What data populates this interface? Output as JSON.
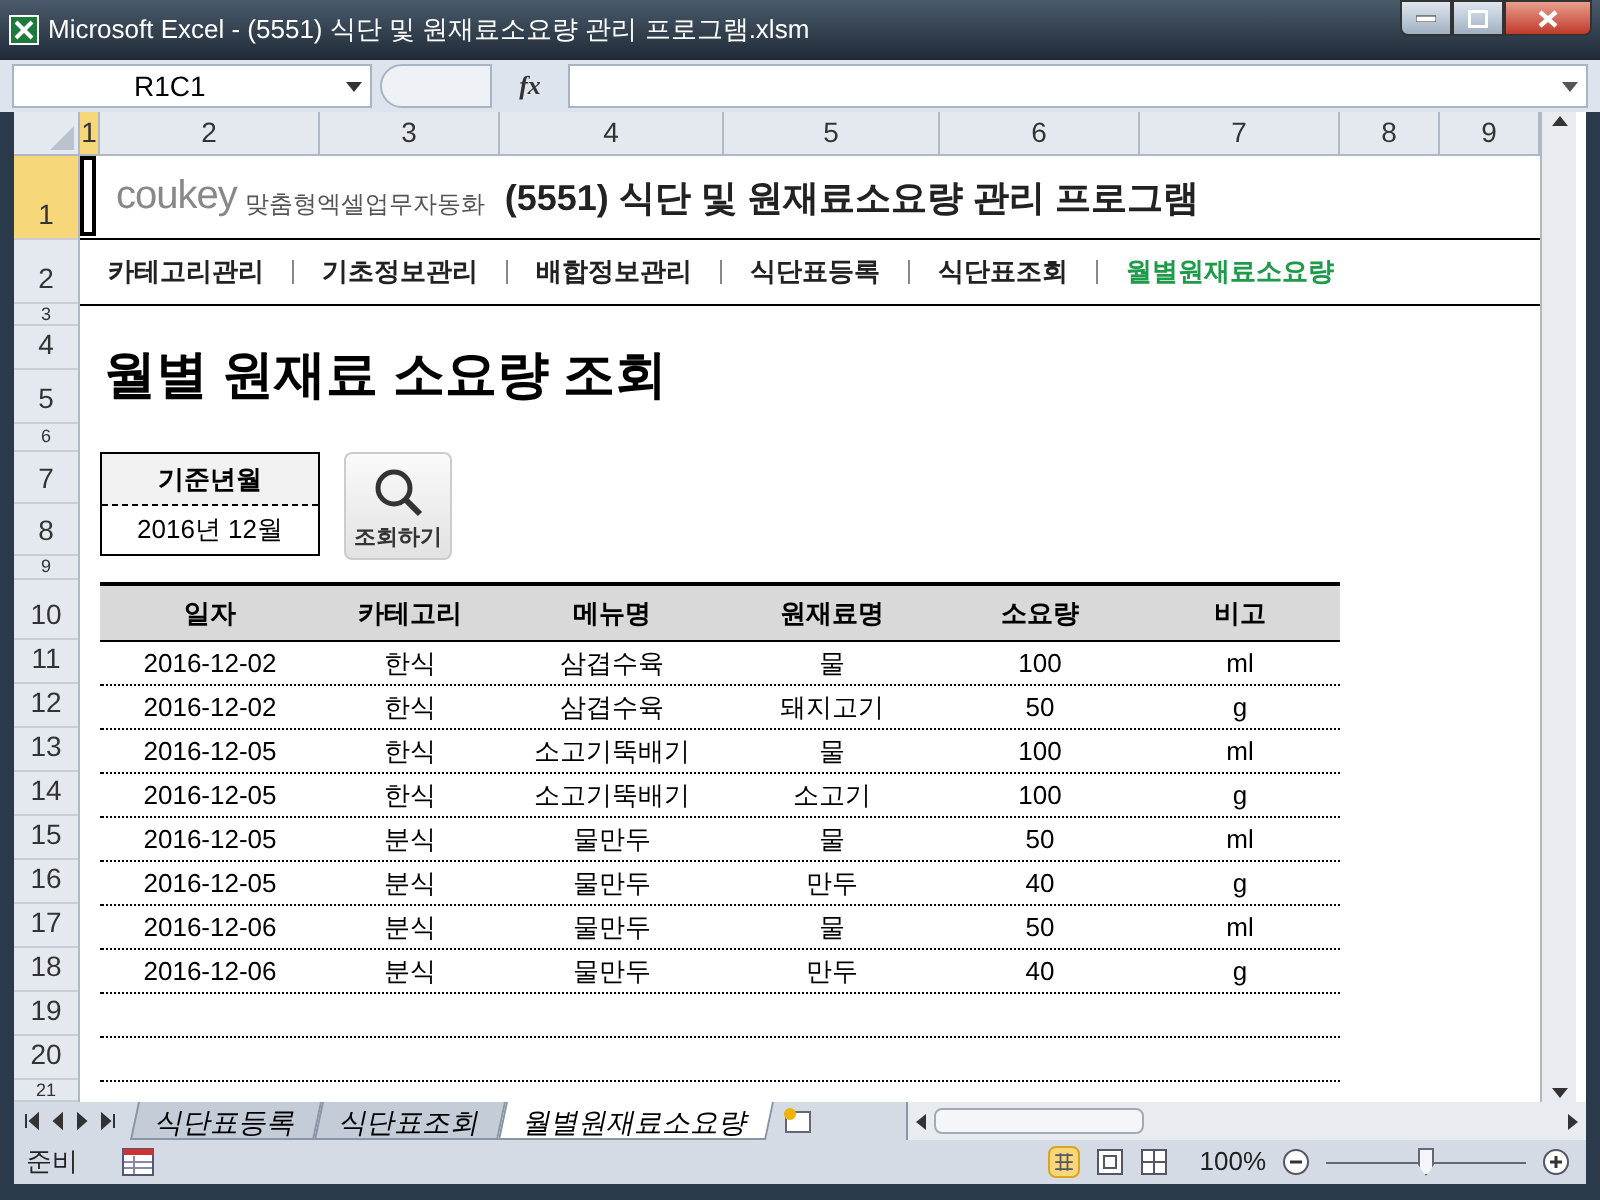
{
  "window": {
    "title": "Microsoft Excel - (5551) 식단 및 원재료소요량 관리 프로그램.xlsm"
  },
  "formula_bar": {
    "name_box": "R1C1",
    "fx": "fx"
  },
  "column_headers": [
    {
      "label": "1",
      "selected": true
    },
    {
      "label": "2",
      "selected": false
    },
    {
      "label": "3",
      "selected": false
    },
    {
      "label": "4",
      "selected": false
    },
    {
      "label": "5",
      "selected": false
    },
    {
      "label": "6",
      "selected": false
    },
    {
      "label": "7",
      "selected": false
    },
    {
      "label": "8",
      "selected": false
    },
    {
      "label": "9",
      "selected": false
    }
  ],
  "row_headers": [
    {
      "label": "1",
      "selected": true
    },
    {
      "label": "2",
      "selected": false
    },
    {
      "label": "3",
      "selected": false
    },
    {
      "label": "4",
      "selected": false
    },
    {
      "label": "5",
      "selected": false
    },
    {
      "label": "6",
      "selected": false
    },
    {
      "label": "7",
      "selected": false
    },
    {
      "label": "8",
      "selected": false
    },
    {
      "label": "9",
      "selected": false
    },
    {
      "label": "10",
      "selected": false
    },
    {
      "label": "11",
      "selected": false
    },
    {
      "label": "12",
      "selected": false
    },
    {
      "label": "13",
      "selected": false
    },
    {
      "label": "14",
      "selected": false
    },
    {
      "label": "15",
      "selected": false
    },
    {
      "label": "16",
      "selected": false
    },
    {
      "label": "17",
      "selected": false
    },
    {
      "label": "18",
      "selected": false
    },
    {
      "label": "19",
      "selected": false
    },
    {
      "label": "20",
      "selected": false
    },
    {
      "label": "21",
      "selected": false
    }
  ],
  "header": {
    "logo": "coukey",
    "tagline": "맞춤형엑셀업무자동화",
    "title": "(5551) 식단 및 원재료소요량 관리 프로그램"
  },
  "nav": [
    {
      "label": "카테고리관리",
      "selected": false
    },
    {
      "label": "기초정보관리",
      "selected": false
    },
    {
      "label": "배합정보관리",
      "selected": false
    },
    {
      "label": "식단표등록",
      "selected": false
    },
    {
      "label": "식단표조회",
      "selected": false
    },
    {
      "label": "월별원재료소요량",
      "selected": true
    }
  ],
  "heading": "월별 원재료 소요량 조회",
  "period": {
    "label": "기준년월",
    "value": "2016년 12월"
  },
  "search_button": "조회하기",
  "table": {
    "columns": [
      "일자",
      "카테고리",
      "메뉴명",
      "원재료명",
      "소요량",
      "비고"
    ],
    "rows": [
      [
        "2016-12-02",
        "한식",
        "삼겹수육",
        "물",
        "100",
        "ml"
      ],
      [
        "2016-12-02",
        "한식",
        "삼겹수육",
        "돼지고기",
        "50",
        "g"
      ],
      [
        "2016-12-05",
        "한식",
        "소고기뚝배기",
        "물",
        "100",
        "ml"
      ],
      [
        "2016-12-05",
        "한식",
        "소고기뚝배기",
        "소고기",
        "100",
        "g"
      ],
      [
        "2016-12-05",
        "분식",
        "물만두",
        "물",
        "50",
        "ml"
      ],
      [
        "2016-12-05",
        "분식",
        "물만두",
        "만두",
        "40",
        "g"
      ],
      [
        "2016-12-06",
        "분식",
        "물만두",
        "물",
        "50",
        "ml"
      ],
      [
        "2016-12-06",
        "분식",
        "물만두",
        "만두",
        "40",
        "g"
      ]
    ]
  },
  "sheet_tabs": [
    {
      "label": "식단표등록",
      "selected": false
    },
    {
      "label": "식단표조회",
      "selected": false
    },
    {
      "label": "월별원재료소요량",
      "selected": true
    }
  ],
  "status_bar": {
    "status": "준비",
    "zoom": "100%",
    "zoom_slider": {
      "level": 0.5
    }
  }
}
